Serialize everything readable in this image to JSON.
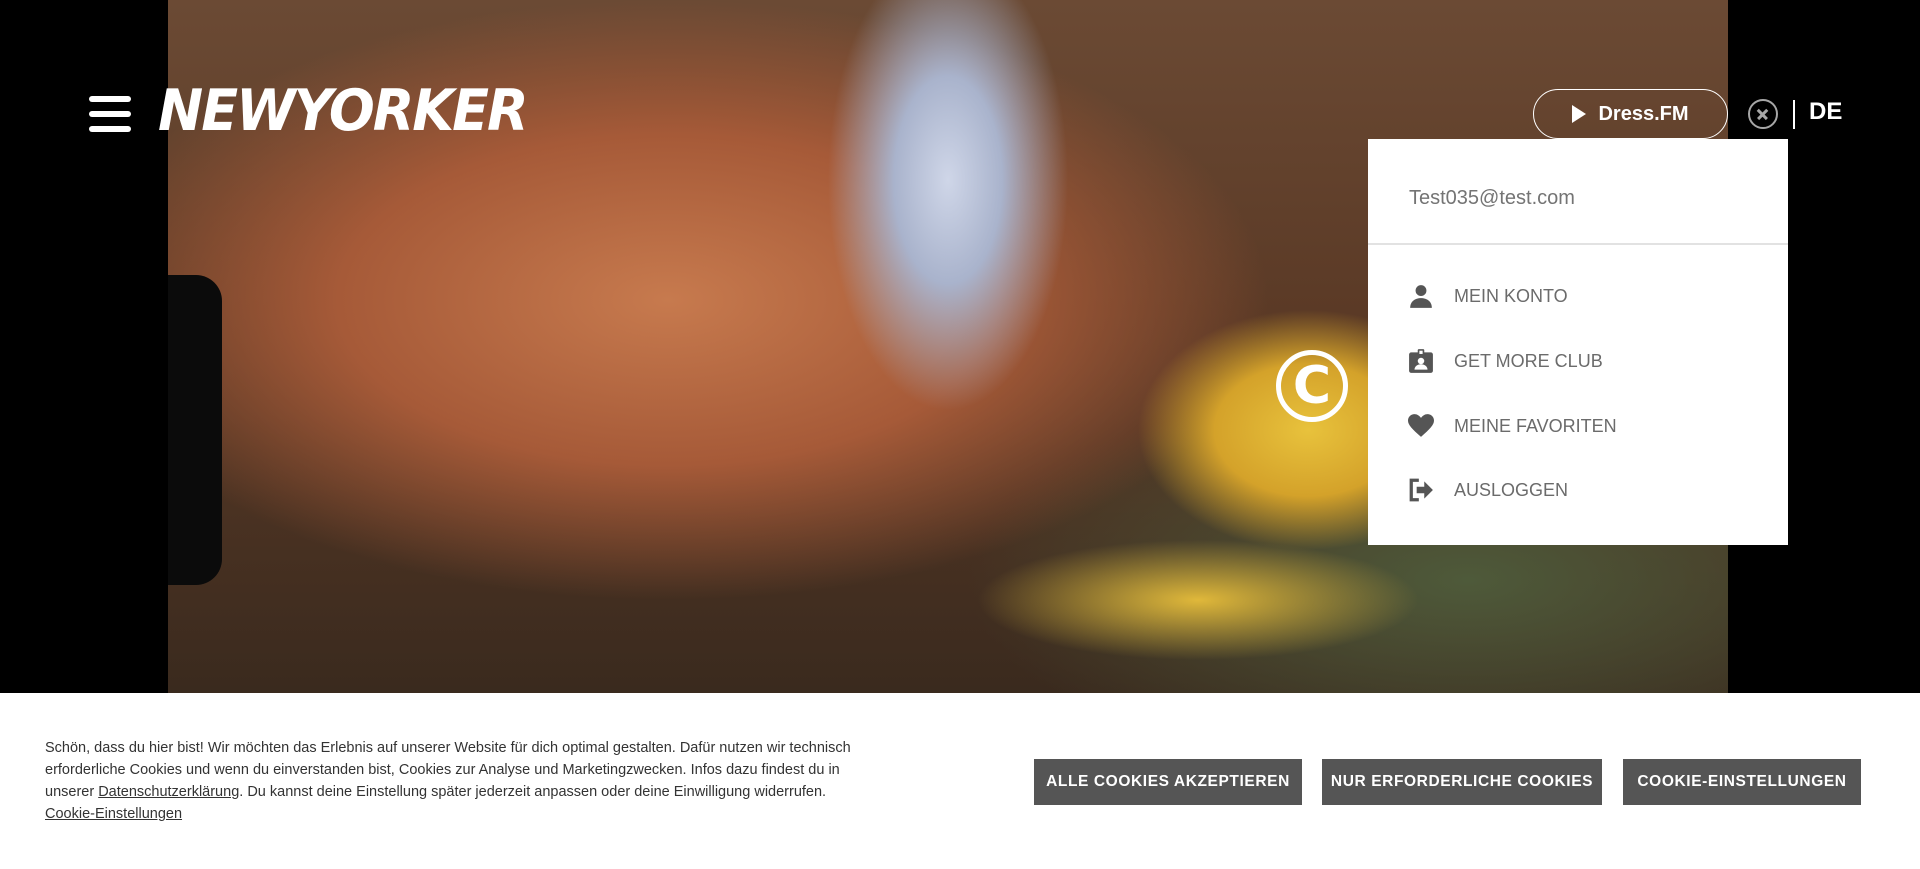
{
  "header": {
    "logo_text": "NEWYORKER",
    "dressfm_label": "Dress.FM",
    "language": "DE"
  },
  "account_menu": {
    "email": "Test035@test.com",
    "items": [
      {
        "label": "MEIN KONTO",
        "icon": "person-icon"
      },
      {
        "label": "GET MORE CLUB",
        "icon": "member-card-icon"
      },
      {
        "label": "MEINE FAVORITEN",
        "icon": "heart-icon"
      },
      {
        "label": "AUSLOGGEN",
        "icon": "logout-icon"
      }
    ]
  },
  "hero": {
    "copyright_symbol": "C"
  },
  "cookie_banner": {
    "text_1": "Schön, dass du hier bist! Wir möchten das Erlebnis auf unserer Website für dich optimal gestalten. Dafür nutzen wir technisch erforderliche Cookies und wenn du einverstanden bist, Cookies zur Analyse und Marketingzwecken. Infos dazu findest du in unserer ",
    "privacy_link": "Datenschutzerklärung",
    "text_2": ". Du kannst deine Einstellung später jederzeit anpassen oder deine Einwilligung widerrufen. ",
    "settings_link": "Cookie-Einstellungen",
    "accept_all": "ALLE COOKIES AKZEPTIEREN",
    "only_required": "NUR ERFORDERLICHE COOKIES",
    "settings_button": "COOKIE-EINSTELLUNGEN"
  },
  "colors": {
    "button_bg": "#555555",
    "menu_text": "#6b6b6b",
    "icon_gray": "#555555"
  }
}
